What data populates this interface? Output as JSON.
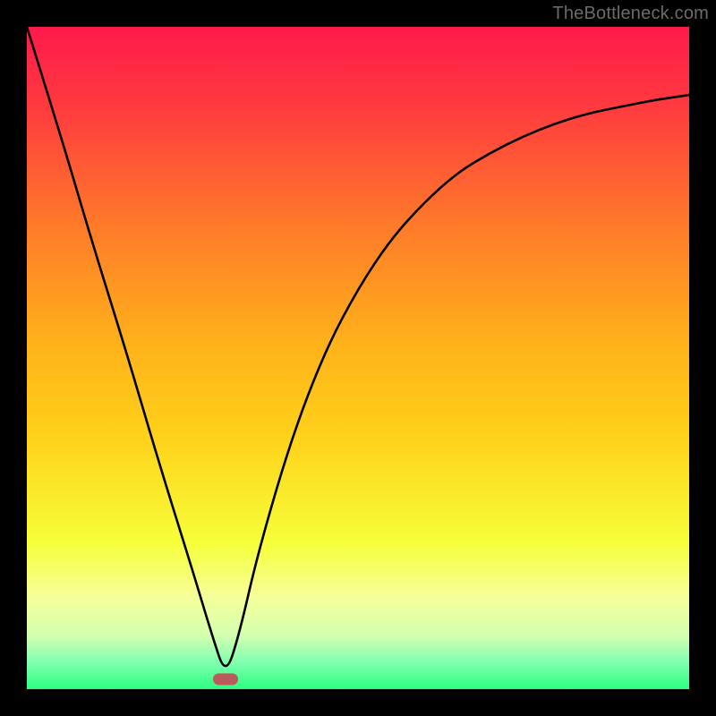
{
  "watermark": "TheBottleneck.com",
  "chart_data": {
    "type": "line",
    "title": "",
    "xlabel": "",
    "ylabel": "",
    "xlim": [
      0,
      100
    ],
    "ylim": [
      0,
      100
    ],
    "grid": false,
    "background_gradient": {
      "top": "#ff1a4b",
      "upper_mid": "#ff7a2a",
      "mid": "#ffd21a",
      "lower_mid": "#f6ff66",
      "bottom": "#2bff7f"
    },
    "marker": {
      "x": 30,
      "y": 1.5,
      "color": "#bb5a5a"
    },
    "series": [
      {
        "name": "curve",
        "x": [
          0,
          5,
          10,
          15,
          20,
          25,
          28,
          30,
          32,
          35,
          40,
          45,
          50,
          55,
          60,
          65,
          70,
          75,
          80,
          85,
          90,
          95,
          100
        ],
        "y": [
          100,
          84,
          67,
          51,
          34,
          18,
          8,
          2,
          8,
          21,
          38,
          51,
          60.5,
          68,
          73.5,
          78,
          81,
          83.5,
          85.5,
          87,
          88,
          89,
          89.7
        ]
      }
    ]
  }
}
